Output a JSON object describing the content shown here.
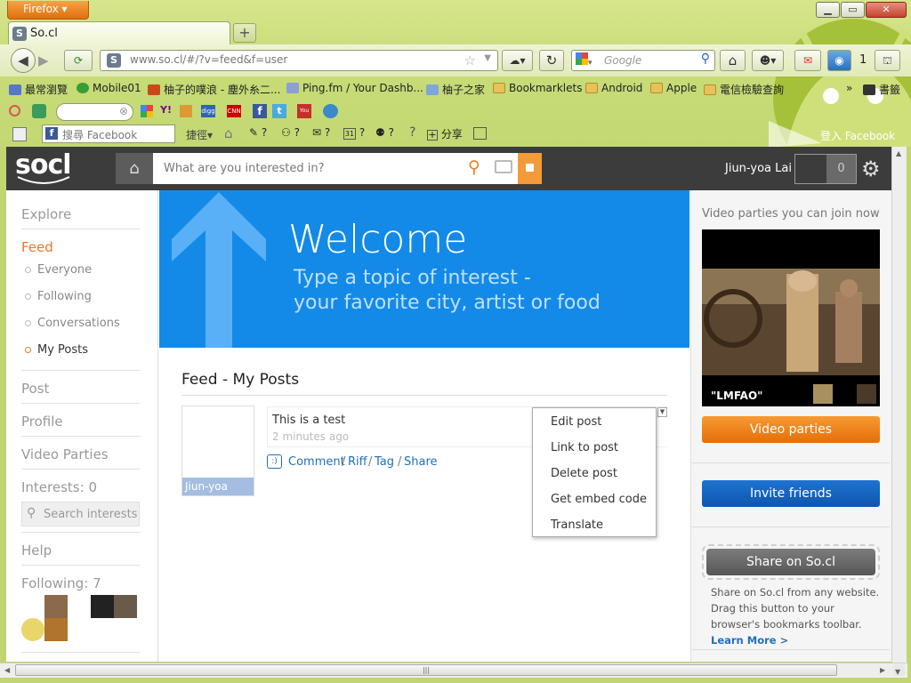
{
  "browser": {
    "menu_button": "Firefox",
    "tab_title": "So.cl",
    "url": "www.so.cl/#/?v=feed&f=user",
    "search_placeholder": "Google",
    "rss_count": "1",
    "facebook_login": "登入 Facebook",
    "bookmarks": [
      {
        "label": "最常瀏覽"
      },
      {
        "label": "Mobile01"
      },
      {
        "label": "柚子的噗浪 - 塵外糸二..."
      },
      {
        "label": "Ping.fm / Your Dashb..."
      },
      {
        "label": "柚子之家"
      },
      {
        "label": "Bookmarklets"
      },
      {
        "label": "Android"
      },
      {
        "label": "Apple"
      },
      {
        "label": "電信檢驗查詢"
      },
      {
        "label": "書籤"
      }
    ],
    "fb_search_placeholder": "搜尋 Facebook",
    "toolbar": {
      "shortcut_label": "捷徑",
      "q1": "?",
      "q2": "?",
      "q3": "?",
      "calendar_day": "31",
      "q4": "?",
      "q5": "?",
      "share_label": "分享"
    }
  },
  "socl": {
    "logo": "socl",
    "search_placeholder": "What are you interested in?",
    "user_name": "Jiun-yoa Lai",
    "notification_count": "0",
    "nav": {
      "explore": "Explore",
      "feed": "Feed",
      "everyone": "Everyone",
      "following": "Following",
      "conversations": "Conversations",
      "my_posts": "My Posts",
      "post": "Post",
      "profile": "Profile",
      "video_parties": "Video Parties",
      "interests": "Interests: 0",
      "search_interests": "Search interests",
      "help": "Help",
      "following_count": "Following: 7"
    },
    "banner": {
      "title": "Welcome",
      "line1": "Type a topic of interest -",
      "line2": "your favorite city, artist or food"
    },
    "feed_title": "Feed - My Posts",
    "post": {
      "author": "Jiun-yoa",
      "text": "This is a test",
      "time": "2 minutes ago",
      "actions": [
        "Comment",
        "Riff",
        "Tag",
        "Share"
      ]
    },
    "menu": [
      "Edit post",
      "Link to post",
      "Delete post",
      "Get embed code",
      "Translate"
    ],
    "right": {
      "video_label": "Video parties you can join now",
      "video_caption": "\"LMFAO\"",
      "video_button": "Video parties",
      "invite_button": "Invite friends",
      "share_button": "Share on So.cl",
      "share_text": "Share on So.cl from any website. Drag this button to your browser's bookmarks toolbar.",
      "learn_more": "Learn More >"
    }
  }
}
